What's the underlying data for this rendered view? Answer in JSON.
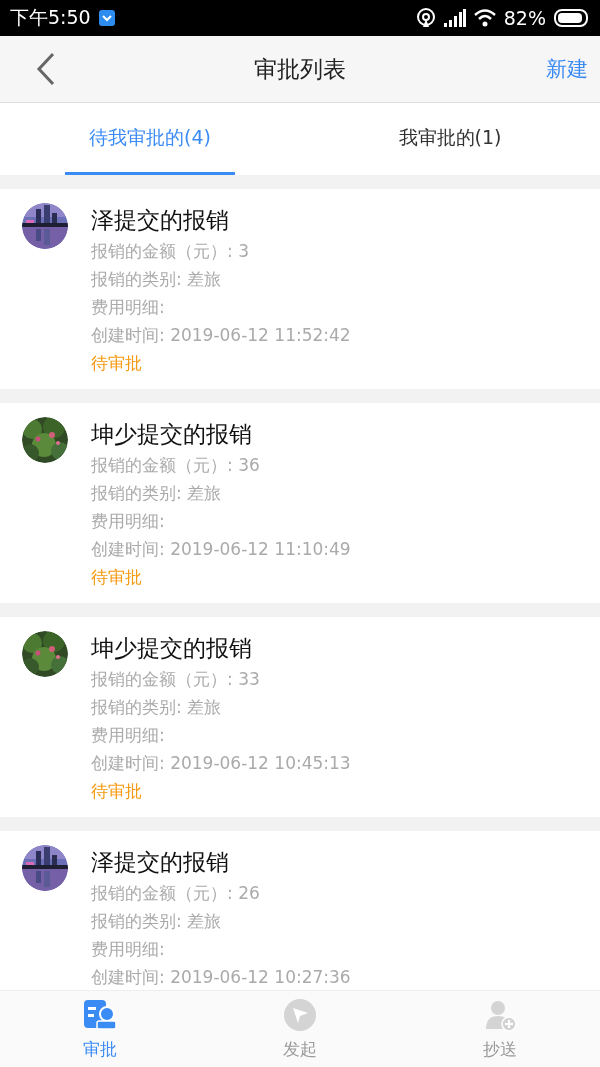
{
  "status_bar": {
    "time": "下午5:50",
    "battery": "82%"
  },
  "header": {
    "title": "审批列表",
    "action": "新建"
  },
  "tabs": [
    {
      "label": "待我审批的(4)",
      "selected": true
    },
    {
      "label": "我审批的(1)",
      "selected": false
    }
  ],
  "items": [
    {
      "title": "泽提交的报销",
      "lines": [
        "报销的金额（元）: 3",
        "报销的类别: 差旅",
        "费用明细:",
        "创建时间: 2019-06-12 11:52:42"
      ],
      "status": "待审批"
    },
    {
      "title": "坤少提交的报销",
      "lines": [
        "报销的金额（元）: 36",
        "报销的类别: 差旅",
        "费用明细:",
        "创建时间: 2019-06-12 11:10:49"
      ],
      "status": "待审批"
    },
    {
      "title": "坤少提交的报销",
      "lines": [
        "报销的金额（元）: 33",
        "报销的类别: 差旅",
        "费用明细:",
        "创建时间: 2019-06-12 10:45:13"
      ],
      "status": "待审批"
    },
    {
      "title": "泽提交的报销",
      "lines": [
        "报销的金额（元）: 26",
        "报销的类别: 差旅",
        "费用明细:",
        "创建时间: 2019-06-12 10:27:36"
      ]
    }
  ],
  "bottom_nav": [
    {
      "label": "审批",
      "kind": "approval",
      "selected": true
    },
    {
      "label": "发起",
      "kind": "send",
      "selected": false
    },
    {
      "label": "抄送",
      "kind": "cc",
      "selected": false
    }
  ]
}
